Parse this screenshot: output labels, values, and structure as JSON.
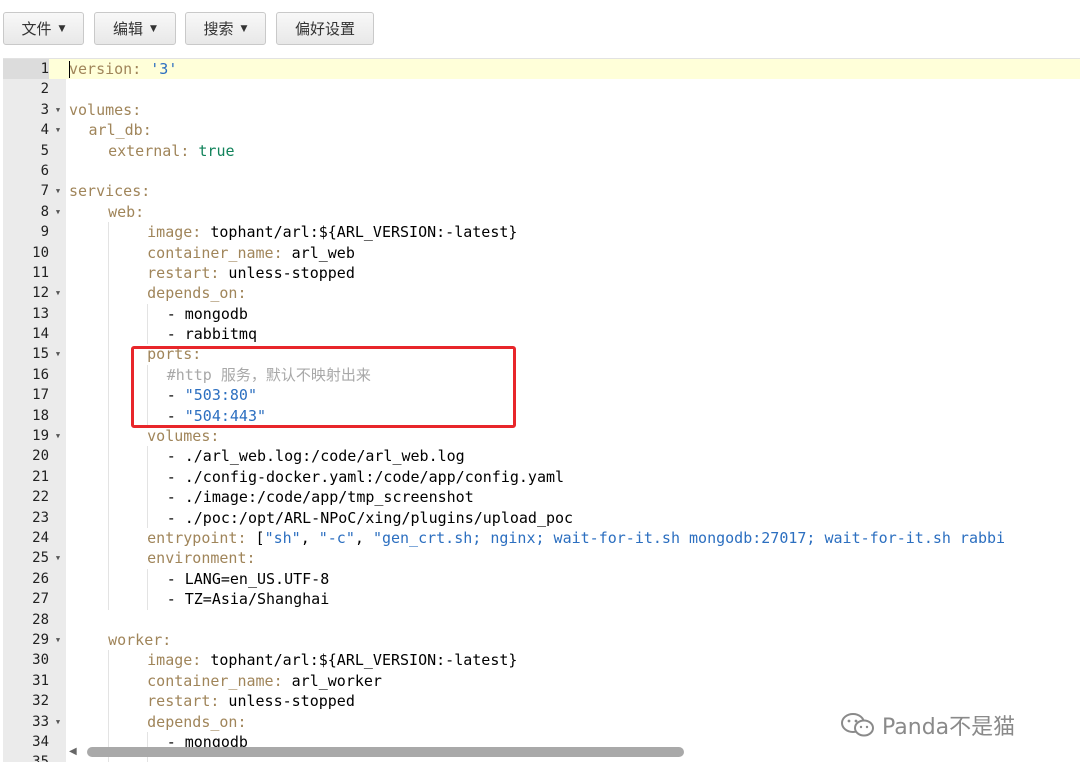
{
  "toolbar": {
    "file": "文件",
    "edit": "编辑",
    "search": "搜索",
    "preferences": "偏好设置"
  },
  "editor": {
    "lines": [
      {
        "n": "1",
        "fold": "",
        "indent": 0,
        "tokens": [
          {
            "t": "version:",
            "c": "k"
          },
          {
            "t": " ",
            "c": ""
          },
          {
            "t": "'3'",
            "c": "s"
          }
        ]
      },
      {
        "n": "2",
        "fold": "",
        "indent": 0,
        "tokens": []
      },
      {
        "n": "3",
        "fold": "▼",
        "indent": 0,
        "tokens": [
          {
            "t": "volumes:",
            "c": "k"
          }
        ]
      },
      {
        "n": "4",
        "fold": "▼",
        "indent": 2,
        "tokens": [
          {
            "t": "arl_db:",
            "c": "k"
          }
        ]
      },
      {
        "n": "5",
        "fold": "",
        "indent": 4,
        "tokens": [
          {
            "t": "external:",
            "c": "k"
          },
          {
            "t": " ",
            "c": ""
          },
          {
            "t": "true",
            "c": "b"
          }
        ]
      },
      {
        "n": "6",
        "fold": "",
        "indent": 0,
        "tokens": []
      },
      {
        "n": "7",
        "fold": "▼",
        "indent": 0,
        "tokens": [
          {
            "t": "services:",
            "c": "k"
          }
        ]
      },
      {
        "n": "8",
        "fold": "▼",
        "indent": 4,
        "tokens": [
          {
            "t": "web:",
            "c": "k"
          }
        ]
      },
      {
        "n": "9",
        "fold": "",
        "indent": 8,
        "tokens": [
          {
            "t": "image:",
            "c": "k"
          },
          {
            "t": " tophant/arl:${ARL_VERSION:-latest}",
            "c": ""
          }
        ]
      },
      {
        "n": "10",
        "fold": "",
        "indent": 8,
        "tokens": [
          {
            "t": "container_name:",
            "c": "k"
          },
          {
            "t": " arl_web",
            "c": ""
          }
        ]
      },
      {
        "n": "11",
        "fold": "",
        "indent": 8,
        "tokens": [
          {
            "t": "restart:",
            "c": "k"
          },
          {
            "t": " unless-stopped",
            "c": ""
          }
        ]
      },
      {
        "n": "12",
        "fold": "▼",
        "indent": 8,
        "tokens": [
          {
            "t": "depends_on:",
            "c": "k"
          }
        ]
      },
      {
        "n": "13",
        "fold": "",
        "indent": 10,
        "tokens": [
          {
            "t": "- mongodb",
            "c": ""
          }
        ]
      },
      {
        "n": "14",
        "fold": "",
        "indent": 10,
        "tokens": [
          {
            "t": "- rabbitmq",
            "c": ""
          }
        ]
      },
      {
        "n": "15",
        "fold": "▼",
        "indent": 8,
        "tokens": [
          {
            "t": "ports:",
            "c": "k"
          }
        ]
      },
      {
        "n": "16",
        "fold": "",
        "indent": 10,
        "tokens": [
          {
            "t": "#http 服务，默认不映射出来",
            "c": "c"
          }
        ]
      },
      {
        "n": "17",
        "fold": "",
        "indent": 10,
        "tokens": [
          {
            "t": "- ",
            "c": ""
          },
          {
            "t": "\"503:80\"",
            "c": "s"
          }
        ]
      },
      {
        "n": "18",
        "fold": "",
        "indent": 10,
        "tokens": [
          {
            "t": "- ",
            "c": ""
          },
          {
            "t": "\"504:443\"",
            "c": "s"
          }
        ]
      },
      {
        "n": "19",
        "fold": "▼",
        "indent": 8,
        "tokens": [
          {
            "t": "volumes:",
            "c": "k"
          }
        ]
      },
      {
        "n": "20",
        "fold": "",
        "indent": 10,
        "tokens": [
          {
            "t": "- ./arl_web.log:/code/arl_web.log",
            "c": ""
          }
        ]
      },
      {
        "n": "21",
        "fold": "",
        "indent": 10,
        "tokens": [
          {
            "t": "- ./config-docker.yaml:/code/app/config.yaml",
            "c": ""
          }
        ]
      },
      {
        "n": "22",
        "fold": "",
        "indent": 10,
        "tokens": [
          {
            "t": "- ./image:/code/app/tmp_screenshot",
            "c": ""
          }
        ]
      },
      {
        "n": "23",
        "fold": "",
        "indent": 10,
        "tokens": [
          {
            "t": "- ./poc:/opt/ARL-NPoC/xing/plugins/upload_poc",
            "c": ""
          }
        ]
      },
      {
        "n": "24",
        "fold": "",
        "indent": 8,
        "tokens": [
          {
            "t": "entrypoint:",
            "c": "k"
          },
          {
            "t": " [",
            "c": ""
          },
          {
            "t": "\"sh\"",
            "c": "s"
          },
          {
            "t": ", ",
            "c": ""
          },
          {
            "t": "\"-c\"",
            "c": "s"
          },
          {
            "t": ", ",
            "c": ""
          },
          {
            "t": "\"gen_crt.sh; nginx; wait-for-it.sh mongodb:27017; wait-for-it.sh rabbi",
            "c": "s"
          }
        ]
      },
      {
        "n": "25",
        "fold": "▼",
        "indent": 8,
        "tokens": [
          {
            "t": "environment:",
            "c": "k"
          }
        ]
      },
      {
        "n": "26",
        "fold": "",
        "indent": 10,
        "tokens": [
          {
            "t": "- LANG=en_US.UTF-8",
            "c": ""
          }
        ]
      },
      {
        "n": "27",
        "fold": "",
        "indent": 10,
        "tokens": [
          {
            "t": "- TZ=Asia/Shanghai",
            "c": ""
          }
        ]
      },
      {
        "n": "28",
        "fold": "",
        "indent": 0,
        "tokens": []
      },
      {
        "n": "29",
        "fold": "▼",
        "indent": 4,
        "tokens": [
          {
            "t": "worker:",
            "c": "k"
          }
        ]
      },
      {
        "n": "30",
        "fold": "",
        "indent": 8,
        "tokens": [
          {
            "t": "image:",
            "c": "k"
          },
          {
            "t": " tophant/arl:${ARL_VERSION:-latest}",
            "c": ""
          }
        ]
      },
      {
        "n": "31",
        "fold": "",
        "indent": 8,
        "tokens": [
          {
            "t": "container_name:",
            "c": "k"
          },
          {
            "t": " arl_worker",
            "c": ""
          }
        ]
      },
      {
        "n": "32",
        "fold": "",
        "indent": 8,
        "tokens": [
          {
            "t": "restart:",
            "c": "k"
          },
          {
            "t": " unless-stopped",
            "c": ""
          }
        ]
      },
      {
        "n": "33",
        "fold": "▼",
        "indent": 8,
        "tokens": [
          {
            "t": "depends_on:",
            "c": "k"
          }
        ]
      },
      {
        "n": "34",
        "fold": "",
        "indent": 10,
        "tokens": [
          {
            "t": "- mongodb",
            "c": ""
          }
        ]
      },
      {
        "n": "35",
        "fold": "",
        "indent": 10,
        "tokens": []
      }
    ]
  },
  "watermark": {
    "text": "Panda不是猫",
    "icon": "wechat-icon"
  },
  "colors": {
    "key": "#a0855a",
    "string": "#2c6fc0",
    "bool": "#12835b",
    "comment": "#a8a8a8",
    "highlight": "#e8262a"
  }
}
